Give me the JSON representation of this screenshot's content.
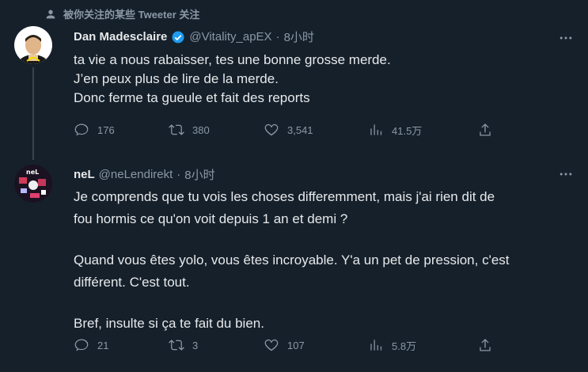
{
  "social_context": {
    "text": "被你关注的某些 Tweeter 关注",
    "icon": "person-icon"
  },
  "tweets": [
    {
      "author_name": "Dan Madesclaire",
      "verified": true,
      "handle": "@Vitality_apEX",
      "separator": "·",
      "time": "8小时",
      "lines": [
        "ta vie a nous rabaisser, tes une bonne grosse merde.",
        "J’en peux plus de lire de la merde.",
        "Donc ferme ta gueule et fait des reports"
      ],
      "stats": {
        "replies": "176",
        "retweets": "380",
        "likes": "3,541",
        "views": "41.5万"
      }
    },
    {
      "author_name": "neL",
      "verified": false,
      "handle": "@neLendirekt",
      "separator": "·",
      "time": "8小时",
      "avatar_text": "neL",
      "lines": [
        "Je comprends que tu vois les choses differemment, mais j'ai rien dit de",
        "fou hormis ce qu'on voit depuis 1 an et demi ?",
        "",
        "Quand vous êtes yolo, vous êtes incroyable. Y'a un pet de pression, c'est",
        "différent. C'est tout.",
        "",
        "Bref, insulte si ça te fait du bien."
      ],
      "stats": {
        "replies": "21",
        "retweets": "3",
        "likes": "107",
        "views": "5.8万"
      }
    }
  ],
  "colors": {
    "background": "#15202b",
    "text": "#e7e9ea",
    "secondary": "#8b98a5",
    "verified": "#1d9bf0",
    "divider": "#38444d"
  }
}
